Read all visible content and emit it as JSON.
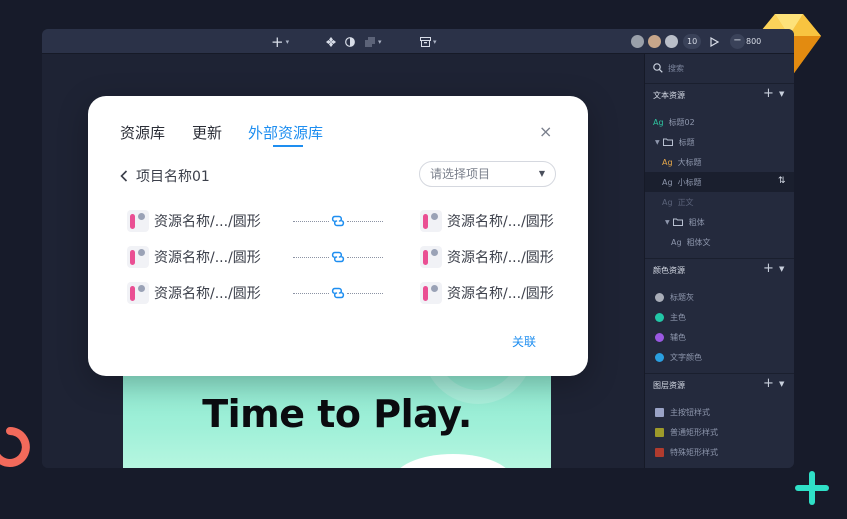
{
  "toolbar": {
    "add_label": "+",
    "avatars_count": "10",
    "zoom_value": "800",
    "zoom_minus": "−"
  },
  "panel": {
    "search_placeholder": "搜索",
    "text_section_title": "文本资源",
    "color_section_title": "颜色资源",
    "layer_section_title": "图层资源",
    "plus_label": "+",
    "ag_label": "Ag",
    "text_items": [
      {
        "label": "标题02",
        "color": "#2ec5a0"
      },
      {
        "label": "标题",
        "color": "#8e97ad"
      },
      {
        "label": "大标题",
        "color": "#e8a94a"
      },
      {
        "label": "小标题",
        "color": "#8e97ad"
      },
      {
        "label": "正文",
        "color": "#5b637a"
      },
      {
        "label": "粗体",
        "color": "#8e97ad"
      },
      {
        "label": "粗体文",
        "color": "#8e97ad"
      }
    ],
    "color_items": [
      {
        "label": "标题灰",
        "color": "#a9adb8"
      },
      {
        "label": "主色",
        "color": "#22c7a7"
      },
      {
        "label": "辅色",
        "color": "#9a58e2"
      },
      {
        "label": "文字颜色",
        "color": "#2a9fe0"
      }
    ],
    "layer_items": [
      {
        "label": "主按钮样式",
        "color": "#9aa3c6"
      },
      {
        "label": "普通矩形样式",
        "color": "#9d9a2a"
      },
      {
        "label": "特殊矩形样式",
        "color": "#b03b2e"
      }
    ]
  },
  "artboard": {
    "headline": "Time to Play."
  },
  "modal": {
    "tabs": [
      "资源库",
      "更新",
      "外部资源库"
    ],
    "active_tab": 2,
    "close_label": "×",
    "back_label": "项目名称01",
    "select_placeholder": "请选择项目",
    "rows": [
      {
        "left": "资源名称/.../圆形",
        "right": "资源名称/.../圆形"
      },
      {
        "left": "资源名称/.../圆形",
        "right": "资源名称/.../圆形"
      },
      {
        "left": "资源名称/.../圆形",
        "right": "资源名称/.../圆形"
      }
    ],
    "confirm_label": "关联"
  },
  "colors": {
    "accent": "#1e8ef0",
    "resource_bar": "#ea4f93",
    "sketch_yellow": "#f7b52a",
    "deco_coral": "#f26a5b",
    "deco_teal": "#2fe0c7"
  }
}
